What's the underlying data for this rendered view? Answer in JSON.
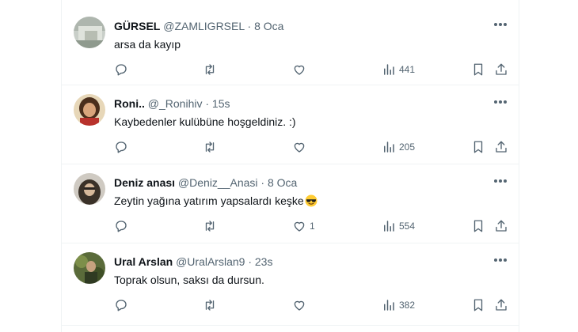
{
  "tweets": [
    {
      "name": "GÜRSEL",
      "handle": "@ZAMLIGRSEL",
      "time": "8 Oca",
      "text": "arsa da kayıp",
      "likes": "",
      "views": "441"
    },
    {
      "name": "Roni..",
      "handle": "@_Ronihiv",
      "time": "15s",
      "text": "Kaybedenler kulübüne hoşgeldiniz. :)",
      "likes": "",
      "views": "205"
    },
    {
      "name": "Deniz anası",
      "handle": "@Deniz__Anasi",
      "time": "8 Oca",
      "text": "Zeytin yağına yatırım yapsalardı keşke",
      "likes": "1",
      "views": "554"
    },
    {
      "name": "Ural Arslan",
      "handle": "@UralArslan9",
      "time": "23s",
      "text": "Toprak olsun, saksı da dursun.",
      "likes": "",
      "views": "382"
    }
  ],
  "separator": "·",
  "icons": {
    "more": "more-horizontal-icon",
    "reply": "reply-icon",
    "retweet": "retweet-icon",
    "like": "heart-icon",
    "views": "views-chart-icon",
    "bookmark": "bookmark-icon",
    "share": "share-icon",
    "emoji": "sunglasses-emoji-icon"
  },
  "colors": {
    "text": "#0f1419",
    "secondary": "#536471",
    "border": "#eff3f4"
  }
}
